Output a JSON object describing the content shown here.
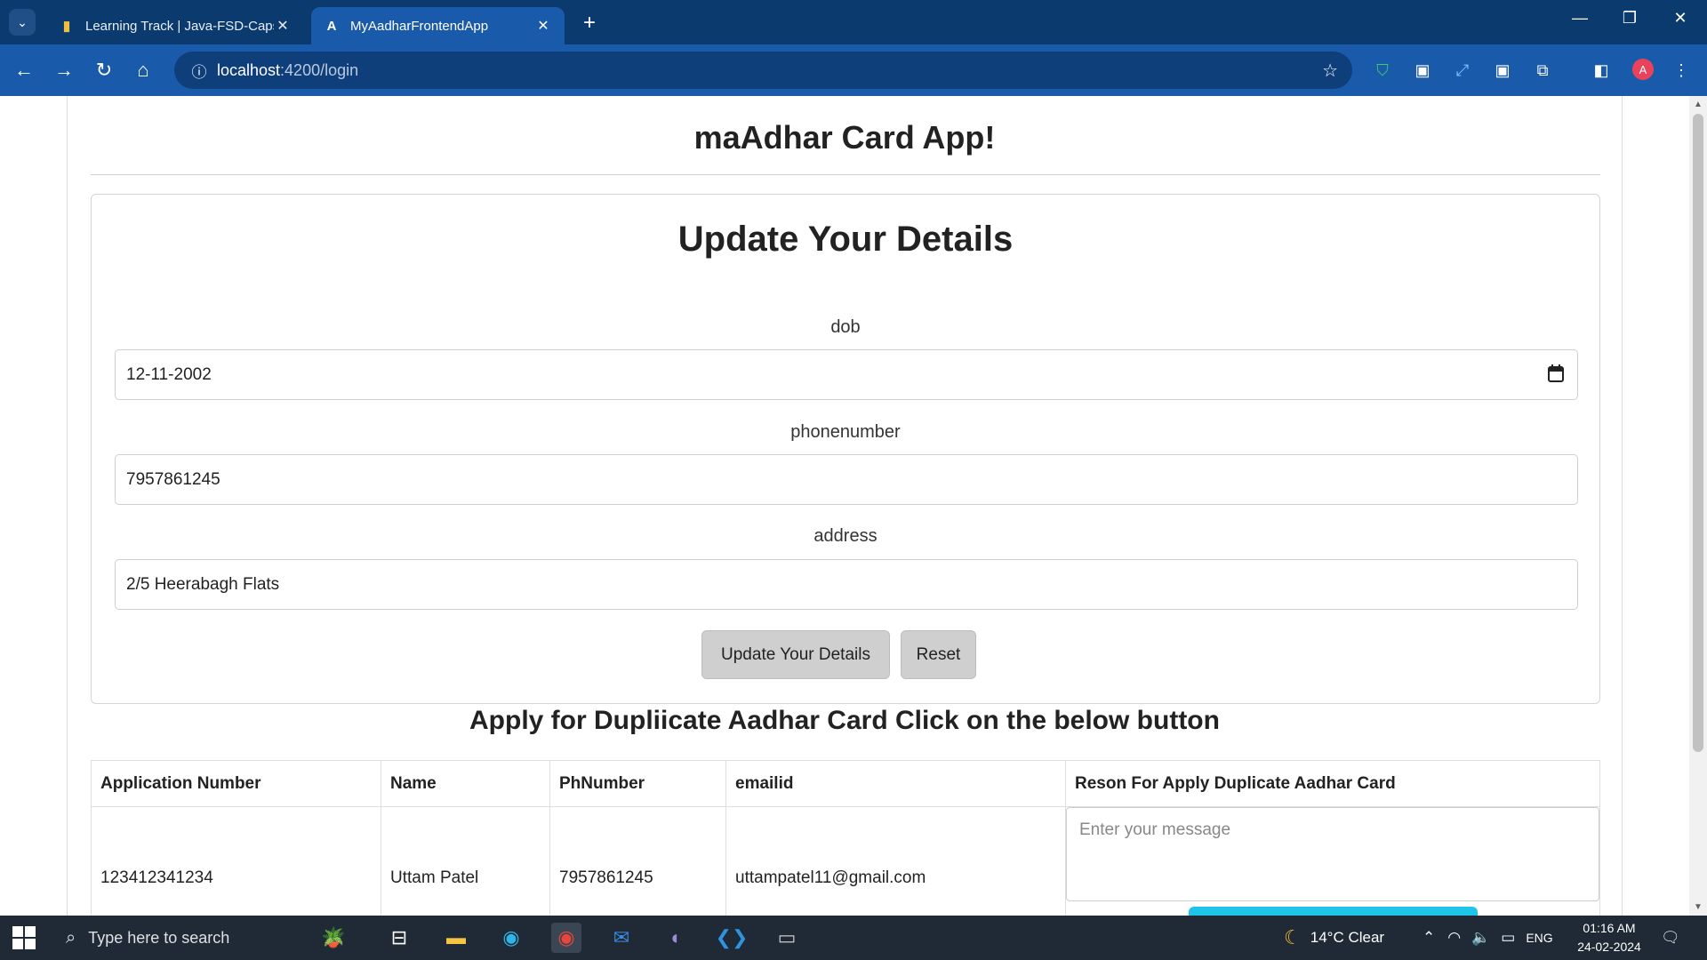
{
  "browser": {
    "tabs": [
      {
        "title": "Learning Track | Java-FSD-Capst",
        "favicon": "bar-chart-icon",
        "active": false
      },
      {
        "title": "MyAadharFrontendApp",
        "favicon": "angular-icon",
        "active": true
      }
    ],
    "url_host": "localhost",
    "url_path": ":4200/login",
    "profile_initial": "A"
  },
  "page": {
    "app_title": "maAdhar Card App!",
    "form": {
      "title": "Update Your Details",
      "dob_label": "dob",
      "dob_value": "12-11-2002",
      "phone_label": "phonenumber",
      "phone_value": "7957861245",
      "address_label": "address",
      "address_value": "2/5 Heerabagh Flats",
      "update_button": "Update Your Details",
      "reset_button": "Reset"
    },
    "duplicate_heading": "Apply for Dupliicate Aadhar Card Click on the below button",
    "table": {
      "headers": [
        "Application Number",
        "Name",
        "PhNumber",
        "emailid",
        "Reson For Apply Duplicate Aadhar Card"
      ],
      "rows": [
        {
          "application_number": "123412341234",
          "name": "Uttam Patel",
          "phnumber": "7957861245",
          "emailid": "uttampatel11@gmail.com"
        }
      ],
      "message_placeholder": "Enter your message"
    }
  },
  "taskbar": {
    "search_placeholder": "Type here to search",
    "weather": "14°C  Clear",
    "language": "ENG",
    "time": "01:16 AM",
    "date": "24-02-2024"
  },
  "colors": {
    "tabbar": "#0b3a6f",
    "toolbar": "#1a5aab",
    "apply_button": "#1ec5e8",
    "taskbar": "#1f2a36"
  }
}
